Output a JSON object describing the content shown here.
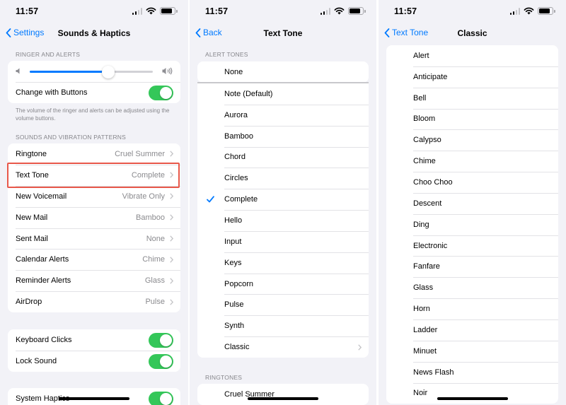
{
  "statusbar": {
    "time": "11:57"
  },
  "screen1": {
    "nav": {
      "back_label": "Settings",
      "title": "Sounds & Haptics"
    },
    "ringer_header": "RINGER AND ALERTS",
    "volume_level": 0.64,
    "change_with_buttons_label": "Change with Buttons",
    "footnote": "The volume of the ringer and alerts can be adjusted using the volume buttons.",
    "patterns_header": "SOUNDS AND VIBRATION PATTERNS",
    "patterns": [
      {
        "label": "Ringtone",
        "value": "Cruel Summer"
      },
      {
        "label": "Text Tone",
        "value": "Complete"
      },
      {
        "label": "New Voicemail",
        "value": "Vibrate Only"
      },
      {
        "label": "New Mail",
        "value": "Bamboo"
      },
      {
        "label": "Sent Mail",
        "value": "None"
      },
      {
        "label": "Calendar Alerts",
        "value": "Chime"
      },
      {
        "label": "Reminder Alerts",
        "value": "Glass"
      },
      {
        "label": "AirDrop",
        "value": "Pulse"
      }
    ],
    "keyboard_clicks_label": "Keyboard Clicks",
    "lock_sound_label": "Lock Sound",
    "system_haptics_label": "System Haptics"
  },
  "screen2": {
    "nav": {
      "back_label": "Back",
      "title": "Text Tone"
    },
    "alert_tones_header": "ALERT TONES",
    "none_label": "None",
    "tones": [
      "Note (Default)",
      "Aurora",
      "Bamboo",
      "Chord",
      "Circles",
      "Complete",
      "Hello",
      "Input",
      "Keys",
      "Popcorn",
      "Pulse",
      "Synth",
      "Classic"
    ],
    "selected_tone": "Complete",
    "ringtones_header": "RINGTONES",
    "first_ringtone": "Cruel Summer"
  },
  "screen3": {
    "nav": {
      "back_label": "Text Tone",
      "title": "Classic"
    },
    "tones": [
      "Alert",
      "Anticipate",
      "Bell",
      "Bloom",
      "Calypso",
      "Chime",
      "Choo Choo",
      "Descent",
      "Ding",
      "Electronic",
      "Fanfare",
      "Glass",
      "Horn",
      "Ladder",
      "Minuet",
      "News Flash",
      "Noir"
    ]
  },
  "colors": {
    "accent": "#007aff",
    "toggle_on": "#34c759",
    "highlight": "#e8584a"
  }
}
